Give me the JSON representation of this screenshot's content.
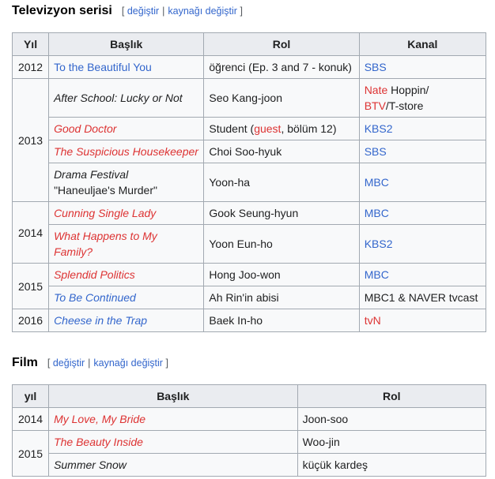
{
  "tv": {
    "title": "Televizyon serisi",
    "edit": {
      "open": "[",
      "edit_label": "değiştir",
      "source_label": "kaynağı değiştir",
      "close": "]"
    },
    "headers": {
      "year": "Yıl",
      "title": "Başlık",
      "role": "Rol",
      "channel": "Kanal"
    },
    "years": {
      "y2012": "2012",
      "y2013": "2013",
      "y2014": "2014",
      "y2015": "2015",
      "y2016": "2016"
    },
    "rows": [
      {
        "title": "To the Beautiful You",
        "role": "öğrenci (Ep. 3 and 7 - konuk)",
        "channel": "SBS"
      },
      {
        "title": "After School: Lucky or Not",
        "role": "Seo Kang-joon",
        "channel_a": "Nate",
        "channel_b": " Hoppin/",
        "channel_c": "BTV",
        "channel_d": "/T-store"
      },
      {
        "title": "Good Doctor",
        "role_a": "Student (",
        "role_b": "guest",
        "role_c": ", bölüm 12)",
        "channel": "KBS2"
      },
      {
        "title": "The Suspicious Housekeeper",
        "role": "Choi Soo-hyuk",
        "channel": "SBS"
      },
      {
        "title_a": "Drama Festival",
        "title_b": "\"Haneuljae's Murder\"",
        "role": "Yoon-ha",
        "channel": "MBC"
      },
      {
        "title": "Cunning Single Lady",
        "role": "Gook Seung-hyun",
        "channel": "MBC"
      },
      {
        "title": "What Happens to My Family?",
        "role": "Yoon Eun-ho",
        "channel": "KBS2"
      },
      {
        "title": "Splendid Politics",
        "role": "Hong Joo-won",
        "channel": "MBC"
      },
      {
        "title": "To Be Continued",
        "role": "Ah Rin'in abisi",
        "channel": "MBC1 & NAVER tvcast"
      },
      {
        "title": "Cheese in the Trap",
        "role": "Baek In-ho",
        "channel": "tvN"
      }
    ]
  },
  "film": {
    "title": "Film",
    "edit": {
      "open": "[",
      "edit_label": "değiştir",
      "source_label": "kaynağı değiştir",
      "close": "]"
    },
    "headers": {
      "year": "yıl",
      "title": "Başlık",
      "role": "Rol"
    },
    "years": {
      "y2014": "2014",
      "y2015": "2015"
    },
    "rows": [
      {
        "title": "My Love, My Bride",
        "role": "Joon-soo"
      },
      {
        "title": "The Beauty Inside",
        "role": "Woo-jin"
      },
      {
        "title": "Summer Snow",
        "role": "küçük kardeş"
      }
    ]
  },
  "colors": {
    "link": "#3366cc",
    "redlink": "#dd3333",
    "header_bg": "#eaecf0",
    "table_bg": "#f8f9fa",
    "border": "#a2a9b1"
  }
}
